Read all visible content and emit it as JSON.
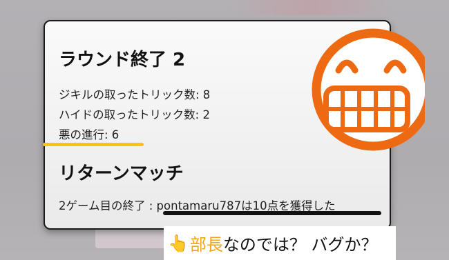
{
  "dialog": {
    "title": "ラウンド終了 2",
    "stats": [
      "ジキルの取ったトリック数: 8",
      "ハイドの取ったトリック数: 2",
      "悪の進行: 6"
    ],
    "subtitle": "リターンマッチ",
    "result": "2ゲーム目の終了 : pontamaru787は10点を獲得した"
  },
  "annotation": {
    "pointer": "👆",
    "highlight": "部長",
    "text": "なのでは？ バグか？",
    "highlight_color": "#f2a516",
    "underline_colors": [
      "#f6c21b",
      "#111111"
    ]
  },
  "emoji": {
    "icon": "grimacing-face-stamp",
    "color": "#ee6a12"
  }
}
